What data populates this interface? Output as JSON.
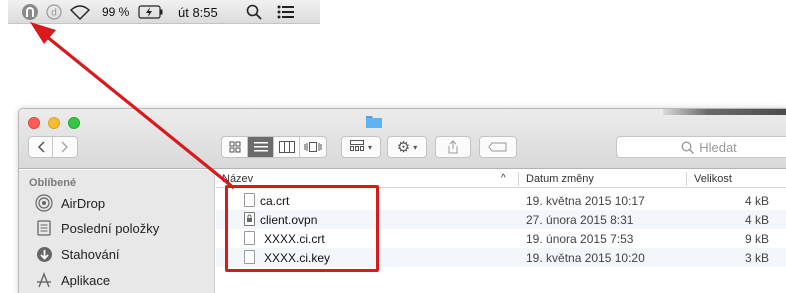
{
  "menubar": {
    "battery": "99 %",
    "clock": "út 8:55",
    "icons": [
      "openvpn-icon",
      "d-circle-icon",
      "wifi-icon",
      "battery-charging-icon",
      "spotlight-search-icon",
      "notification-list-icon"
    ]
  },
  "toolbar": {
    "search_placeholder": "Hledat",
    "view_buttons": [
      "icon-view",
      "list-view",
      "column-view",
      "coverflow-view"
    ],
    "arrange_button": "arrange-icon",
    "action_button": "gear-icon",
    "share_button": "share-icon",
    "tag_button": "tag-icon"
  },
  "sidebar": {
    "heading": "Oblíbené",
    "items": [
      {
        "label": "AirDrop",
        "icon": "airdrop-icon"
      },
      {
        "label": "Poslední položky",
        "icon": "recents-icon"
      },
      {
        "label": "Stahování",
        "icon": "downloads-icon"
      },
      {
        "label": "Aplikace",
        "icon": "applications-icon"
      }
    ]
  },
  "list": {
    "columns": {
      "name": "Název",
      "date": "Datum změny",
      "size": "Velikost",
      "sort_indicator": "^"
    },
    "rows": [
      {
        "name": "ca.crt",
        "date": "19. května 2015 10:17",
        "size": "4 kB"
      },
      {
        "name": "client.ovpn",
        "date": "27. února 2015 8:31",
        "size": "4 kB"
      },
      {
        "name": "XXXX.ci.crt",
        "date": "19. února 2015 7:53",
        "size": "9 kB"
      },
      {
        "name": "XXXX.ci.key",
        "date": "19. května 2015 10:20",
        "size": "3 kB"
      }
    ]
  },
  "colors": {
    "annotation": "#d9191c",
    "traffic_close": "#fc5f57",
    "traffic_min": "#fdbc2e",
    "traffic_max": "#33c748",
    "folder": "#5fb3f0"
  }
}
